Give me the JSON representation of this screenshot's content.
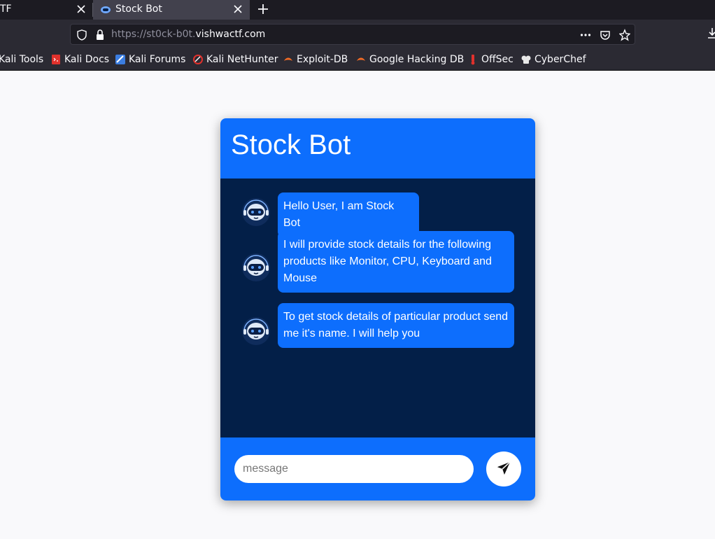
{
  "browser": {
    "tabs": [
      {
        "title": "TF",
        "active": false
      },
      {
        "title": "Stock Bot",
        "active": true
      }
    ],
    "url": {
      "scheme_prefix": "https://st0ck-b0t.",
      "host": "vishwactf.com"
    },
    "bookmarks": [
      {
        "label": "Kali Tools",
        "icon": "kali-icon"
      },
      {
        "label": "Kali Docs",
        "icon": "kali-docs-icon"
      },
      {
        "label": "Kali Forums",
        "icon": "kali-forums-icon"
      },
      {
        "label": "Kali NetHunter",
        "icon": "nethunter-icon"
      },
      {
        "label": "Exploit-DB",
        "icon": "exploit-db-icon"
      },
      {
        "label": "Google Hacking DB",
        "icon": "ghdb-icon"
      },
      {
        "label": "OffSec",
        "icon": "offsec-icon"
      },
      {
        "label": "CyberChef",
        "icon": "cyberchef-icon"
      }
    ]
  },
  "chat": {
    "title": "Stock Bot",
    "messages": [
      {
        "text": "Hello User, I am Stock Bot"
      },
      {
        "text": "I will provide stock details for the following products like Monitor, CPU, Keyboard and Mouse"
      },
      {
        "text": "To get stock details of particular product send me it's name. I will help you"
      }
    ],
    "input": {
      "placeholder": "message",
      "value": ""
    },
    "colors": {
      "header": "#0d6efd",
      "body": "#031f48",
      "bubble": "#0d6efd"
    }
  }
}
